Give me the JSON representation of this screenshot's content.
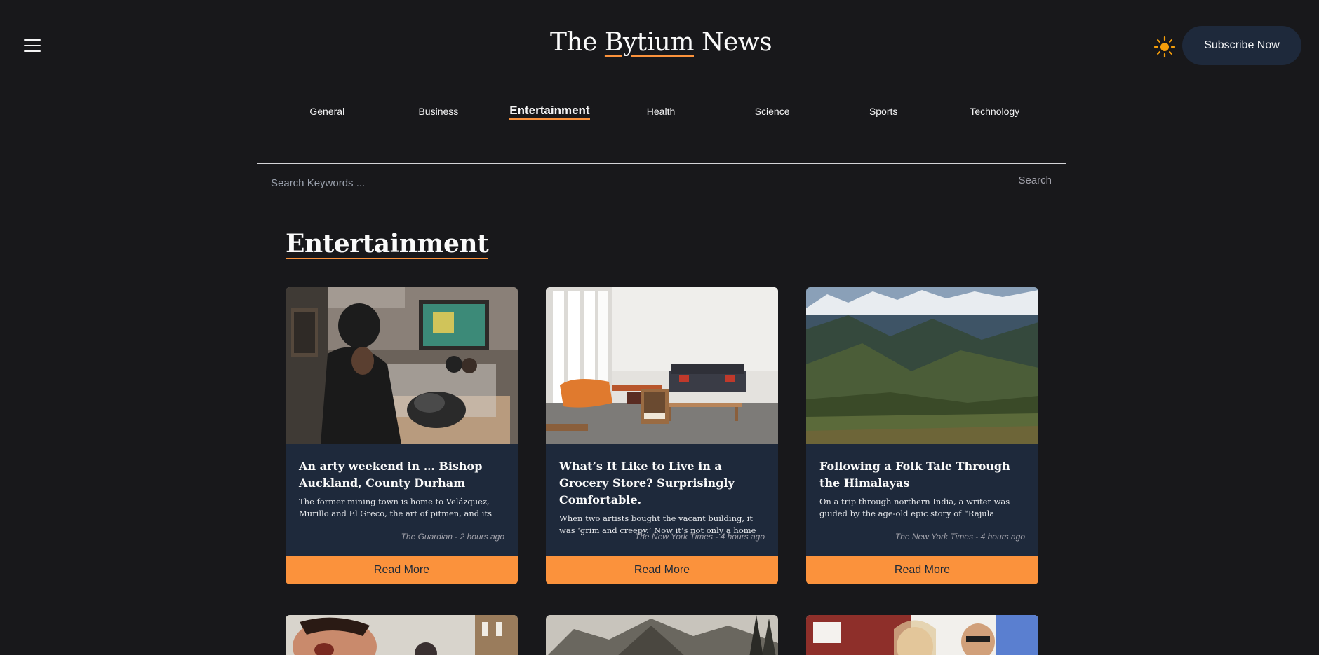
{
  "header": {
    "title_prefix": "The ",
    "title_accent": "Bytium",
    "title_suffix": " News",
    "theme_icon": "sun-icon",
    "menu_icon": "hamburger-menu-icon",
    "subscribe_label": "Subscribe Now"
  },
  "nav": {
    "items": [
      {
        "label": "General"
      },
      {
        "label": "Business"
      },
      {
        "label": "Entertainment"
      },
      {
        "label": "Health"
      },
      {
        "label": "Science"
      },
      {
        "label": "Sports"
      },
      {
        "label": "Technology"
      }
    ],
    "active": "Entertainment"
  },
  "search": {
    "placeholder": "Search Keywords ...",
    "button_label": "Search"
  },
  "section": {
    "title": "Entertainment"
  },
  "articles": [
    {
      "title": "An arty weekend in … Bishop Auckland, County Durham",
      "description": "The former mining town is home to Velázquez, Murillo and El Greco, the art of pitmen, and its own artist-...",
      "meta": "The Guardian - 2 hours ago",
      "read_more": "Read More"
    },
    {
      "title": "What’s It Like to Live in a Grocery Store? Surprisingly Comfortable.",
      "description": "When two artists bought the vacant building, it was ‘grim and creepy.’ Now it’s not only a home — it’s a...",
      "meta": "The New York Times - 4 hours ago",
      "read_more": "Read More"
    },
    {
      "title": "Following a Folk Tale Through the Himalayas",
      "description": "On a trip through northern India, a writer was guided by the age-old epic story of “Rajula Malushahi,” whic...",
      "meta": "The New York Times - 4 hours ago",
      "read_more": "Read More"
    }
  ],
  "colors": {
    "background": "#18181b",
    "card": "#1e293b",
    "accent": "#fb923c",
    "sun": "#f59e0b"
  }
}
